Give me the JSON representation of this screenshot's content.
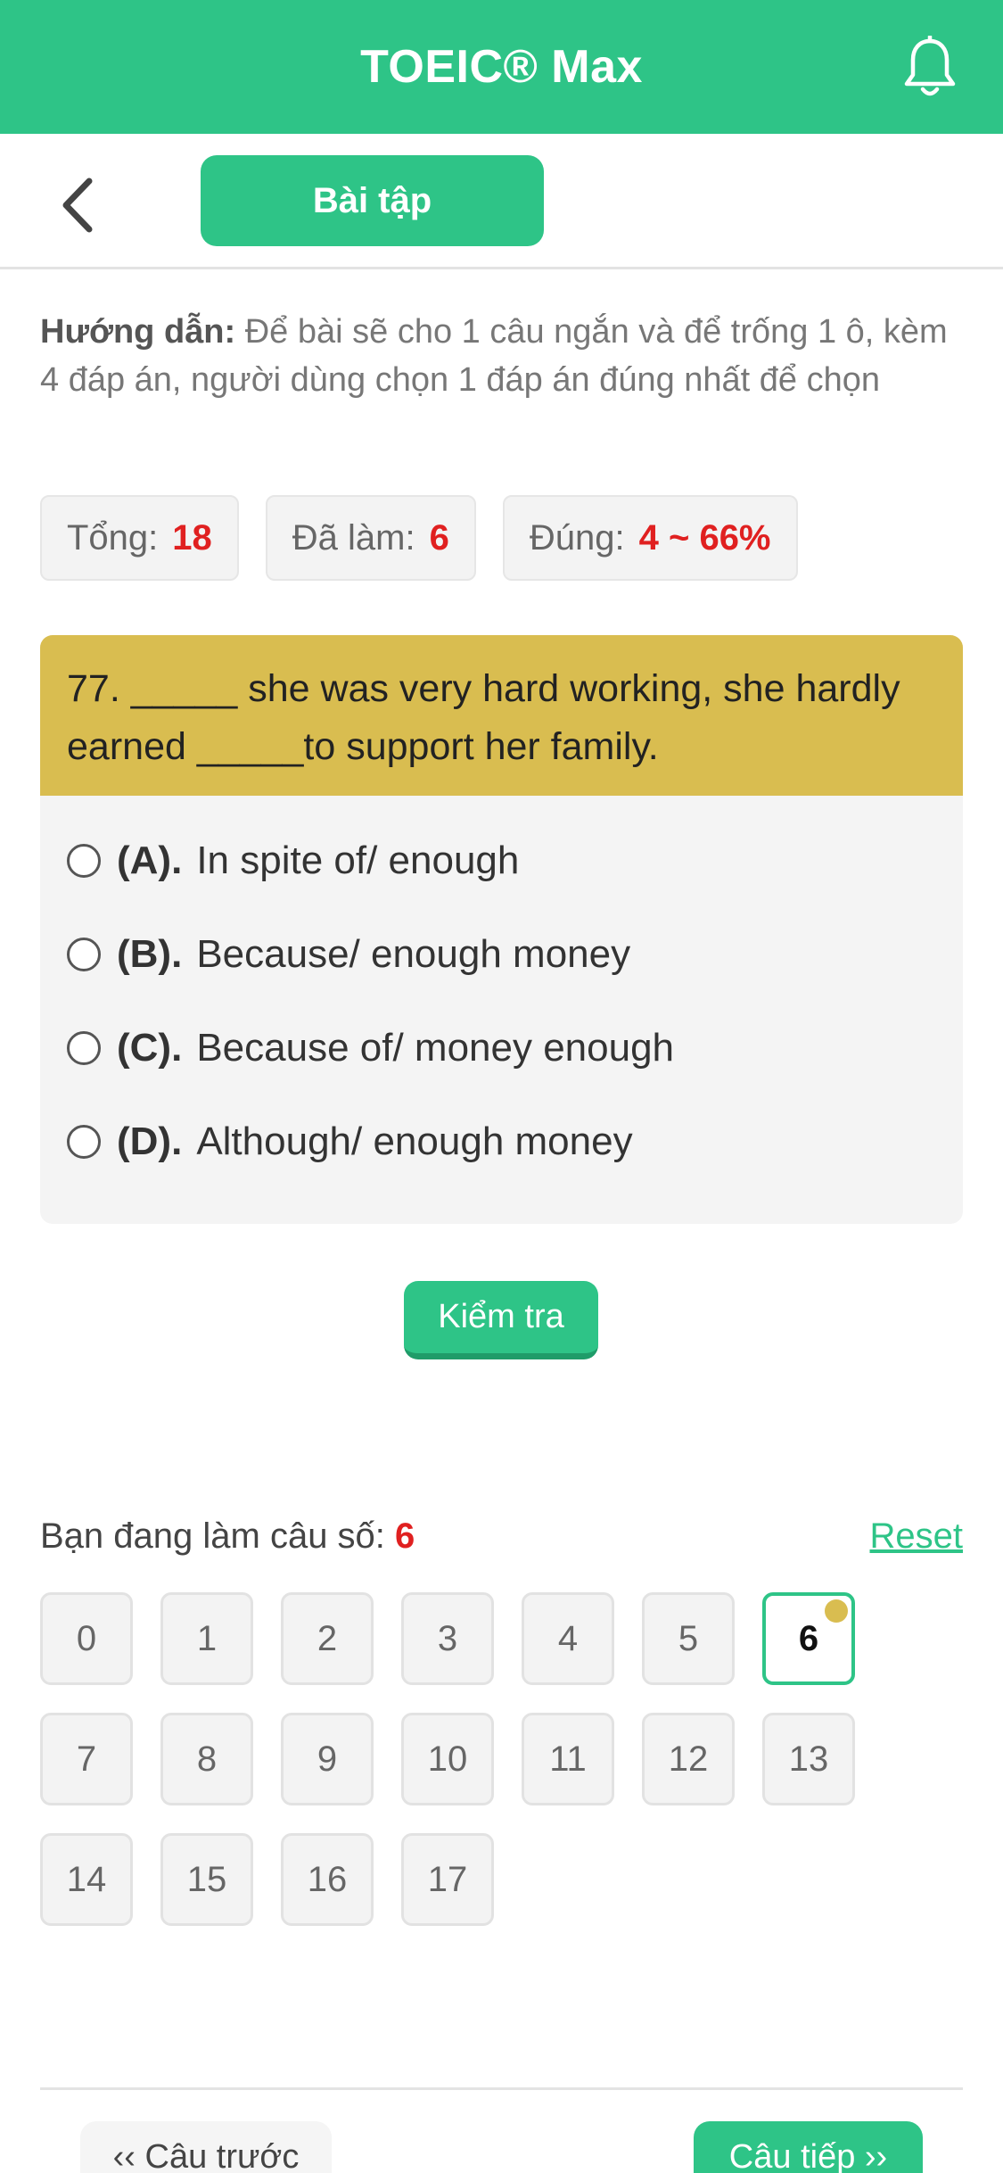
{
  "app": {
    "title": "TOEIC® Max"
  },
  "header": {
    "tab_label": "Bài tập"
  },
  "guide": {
    "label": "Hướng dẫn:",
    "text": " Để bài sẽ cho 1 câu ngắn và để trống 1 ô, kèm 4 đáp án, người dùng chọn 1 đáp án đúng nhất để chọn"
  },
  "stats": {
    "total_label": "Tổng:",
    "total_value": "18",
    "done_label": "Đã làm:",
    "done_value": "6",
    "correct_label": "Đúng:",
    "correct_value": "4 ~ 66%"
  },
  "question": {
    "text": "77. _____ she was very hard working, she hardly earned _____to support her family.",
    "options": [
      {
        "letter": "(A).",
        "text": "In spite of/ enough"
      },
      {
        "letter": "(B).",
        "text": "Because/ enough money"
      },
      {
        "letter": "(C).",
        "text": "Because of/ money enough"
      },
      {
        "letter": "(D).",
        "text": "Although/ enough money"
      }
    ]
  },
  "check_label": "Kiểm tra",
  "progress": {
    "label": "Bạn đang làm câu số: ",
    "current": "6",
    "reset_label": "Reset",
    "numbers": [
      "0",
      "1",
      "2",
      "3",
      "4",
      "5",
      "6",
      "7",
      "8",
      "9",
      "10",
      "11",
      "12",
      "13",
      "14",
      "15",
      "16",
      "17"
    ]
  },
  "nav": {
    "prev_label": "‹‹ Câu trước",
    "next_label": "Câu tiếp ››"
  },
  "colors": {
    "primary": "#2ec487",
    "question_bg": "#d9bd50",
    "accent_red": "#e02020"
  }
}
